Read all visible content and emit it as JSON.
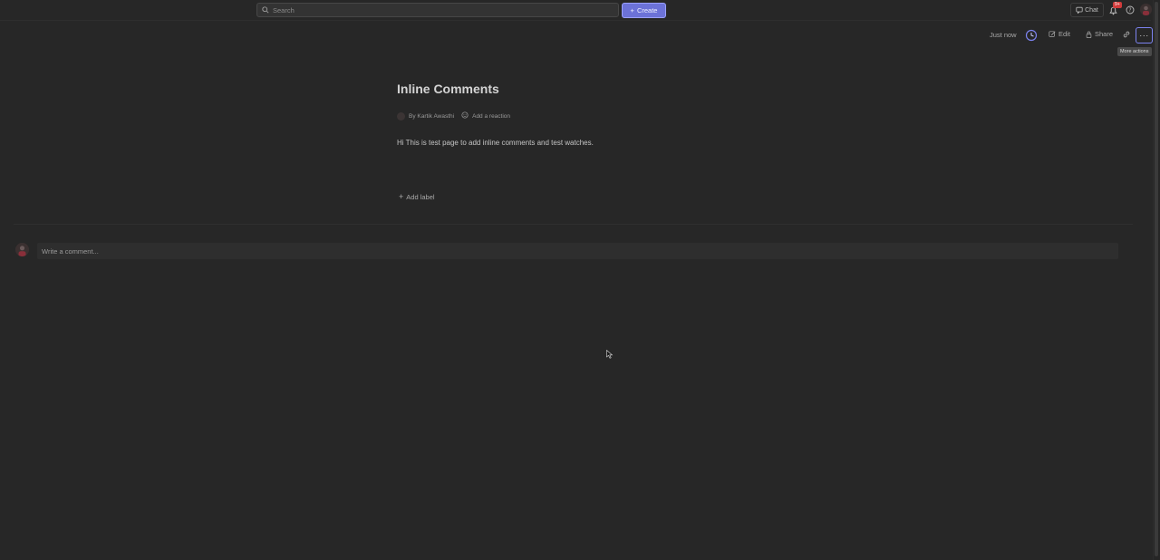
{
  "topbar": {
    "search_placeholder": "Search",
    "create_label": "Create",
    "chat_label": "Chat",
    "notification_badge": "9+"
  },
  "actions": {
    "saved_status": "Just now",
    "edit_label": "Edit",
    "share_label": "Share",
    "more_icon": "···",
    "more_tooltip": "More actions"
  },
  "page": {
    "title": "Inline Comments",
    "author": "By Kartik Awasthi",
    "add_reaction": "Add a reaction",
    "body": "Hi This is test page to add inline comments and test watches.",
    "add_label": "Add label"
  },
  "comment": {
    "placeholder": "Write a comment..."
  },
  "colors": {
    "background": "#272727",
    "accent": "#6c72d8",
    "badge": "#d13b3b"
  }
}
